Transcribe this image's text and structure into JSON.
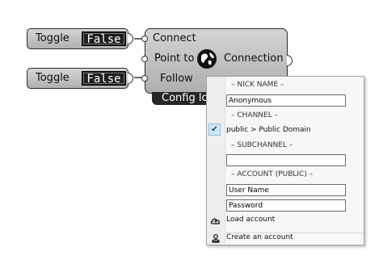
{
  "toggles": [
    {
      "label": "Toggle",
      "value": "False"
    },
    {
      "label": "Toggle",
      "value": "False"
    }
  ],
  "component": {
    "inputs": [
      "Connect",
      "Point to",
      "Follow"
    ],
    "output": "Connection",
    "icon": "globe-icon",
    "config_tab": "Config lo"
  },
  "menu": {
    "nick_name_header": "– NICK NAME –",
    "nick_name_value": "Anonymous",
    "channel_header": "– CHANNEL –",
    "channel_item": "public > Public Domain",
    "subchannel_header": "– SUBCHANNEL –",
    "subchannel_value": "",
    "account_header": "– ACCOUNT (PUBLIC) –",
    "username_value": "User Name",
    "password_value": "Password",
    "load_account": "Load account",
    "create_account": "Create an account"
  }
}
